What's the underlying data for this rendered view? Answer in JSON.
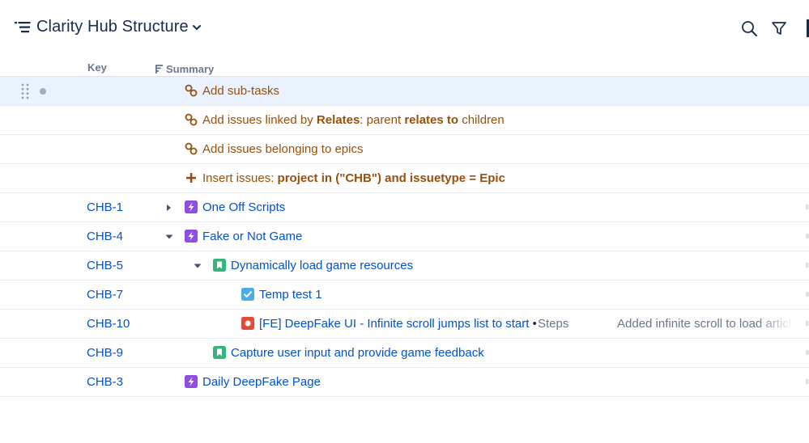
{
  "header": {
    "title": "Clarity Hub Structure",
    "icons": [
      "structure-icon",
      "chevron-down-icon",
      "search-icon",
      "filter-icon"
    ]
  },
  "columns": {
    "key": "Key",
    "summary": "Summary"
  },
  "generators": [
    {
      "prefix": "Add sub-tasks",
      "icon": "link-icon"
    },
    {
      "prefix": "Add issues linked by ",
      "b1": "Relates",
      "mid": ": parent ",
      "b2": "relates to",
      "suffix": " children",
      "icon": "link-icon"
    },
    {
      "prefix": "Add issues belonging to epics",
      "icon": "link-icon"
    },
    {
      "prefix": "Insert issues: ",
      "b1": "project in (\"CHB\") and issuetype = Epic",
      "icon": "plus-icon"
    }
  ],
  "issues": [
    {
      "key": "CHB-1",
      "summary": "One Off Scripts",
      "type": "epic-icon",
      "expand": "collapsed"
    },
    {
      "key": "CHB-4",
      "summary": "Fake or Not Game",
      "type": "epic-icon",
      "expand": "expanded"
    },
    {
      "key": "CHB-5",
      "summary": "Dynamically load game resources",
      "type": "story-icon",
      "expand": "expanded"
    },
    {
      "key": "CHB-7",
      "summary": "Temp test 1",
      "type": "task-icon"
    },
    {
      "key": "CHB-10",
      "summary": "[FE] DeepFake UI - Infinite scroll jumps list to start",
      "type": "bug-icon",
      "separator": "•",
      "steps_label": "Steps",
      "description": "Added infinite scroll to load articles"
    },
    {
      "key": "CHB-9",
      "summary": "Capture user input and provide game feedback",
      "type": "story-icon"
    },
    {
      "key": "CHB-3",
      "summary": "Daily DeepFake Page",
      "type": "epic-icon"
    }
  ],
  "colors": {
    "generator_text": "#974f0c",
    "issue_link": "#0052cc",
    "epic": "#904ee2",
    "story": "#36b37e",
    "task": "#4bade8",
    "bug": "#e5493a",
    "selected_row": "#ebf2ff"
  }
}
